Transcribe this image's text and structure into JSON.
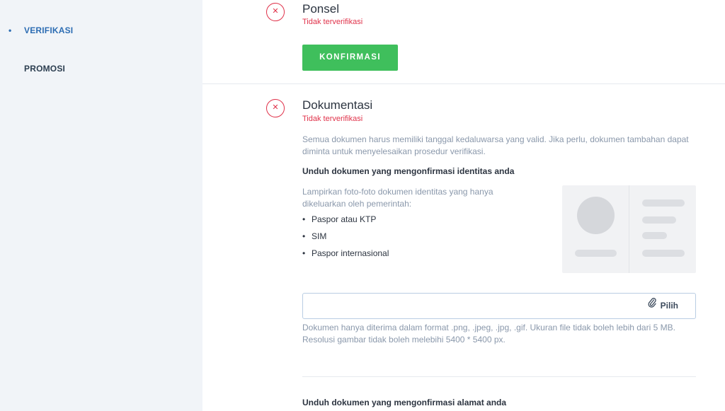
{
  "sidebar": {
    "items": [
      {
        "label": "VERIFIKASI",
        "active": true
      },
      {
        "label": "PROMOSI",
        "active": false
      }
    ]
  },
  "phone": {
    "title": "Ponsel",
    "status": "Tidak terverifikasi",
    "status_icon": "x-circle-icon",
    "confirm_label": "KONFIRMASI"
  },
  "docs": {
    "title": "Dokumentasi",
    "status": "Tidak terverifikasi",
    "status_icon": "x-circle-icon",
    "description": "Semua dokumen harus memiliki tanggal kedaluwarsa yang valid. Jika perlu, dokumen tambahan dapat diminta untuk menyelesaikan prosedur verifikasi.",
    "identity": {
      "heading": "Unduh dokumen yang mengonfirmasi identitas anda",
      "attach_text": "Lampirkan foto-foto dokumen identitas yang hanya dikeluarkan oleh pemerintah:",
      "items": [
        "Paspor atau KTP",
        "SIM",
        "Paspor internasional"
      ],
      "pick_label": "Pilih",
      "pick_icon": "paperclip-icon",
      "note": "Dokumen hanya diterima dalam format .png, .jpeg, .jpg, .gif. Ukuran file tidak boleh lebih dari 5 MB. Resolusi gambar tidak boleh melebihi 5400 * 5400 px."
    },
    "address": {
      "heading": "Unduh dokumen yang mengonfirmasi alamat anda"
    }
  },
  "colors": {
    "accent_blue": "#2d6db3",
    "confirm_green": "#3fbf5c",
    "error_red": "#e0324a",
    "sidebar_bg": "#f1f4f8"
  }
}
